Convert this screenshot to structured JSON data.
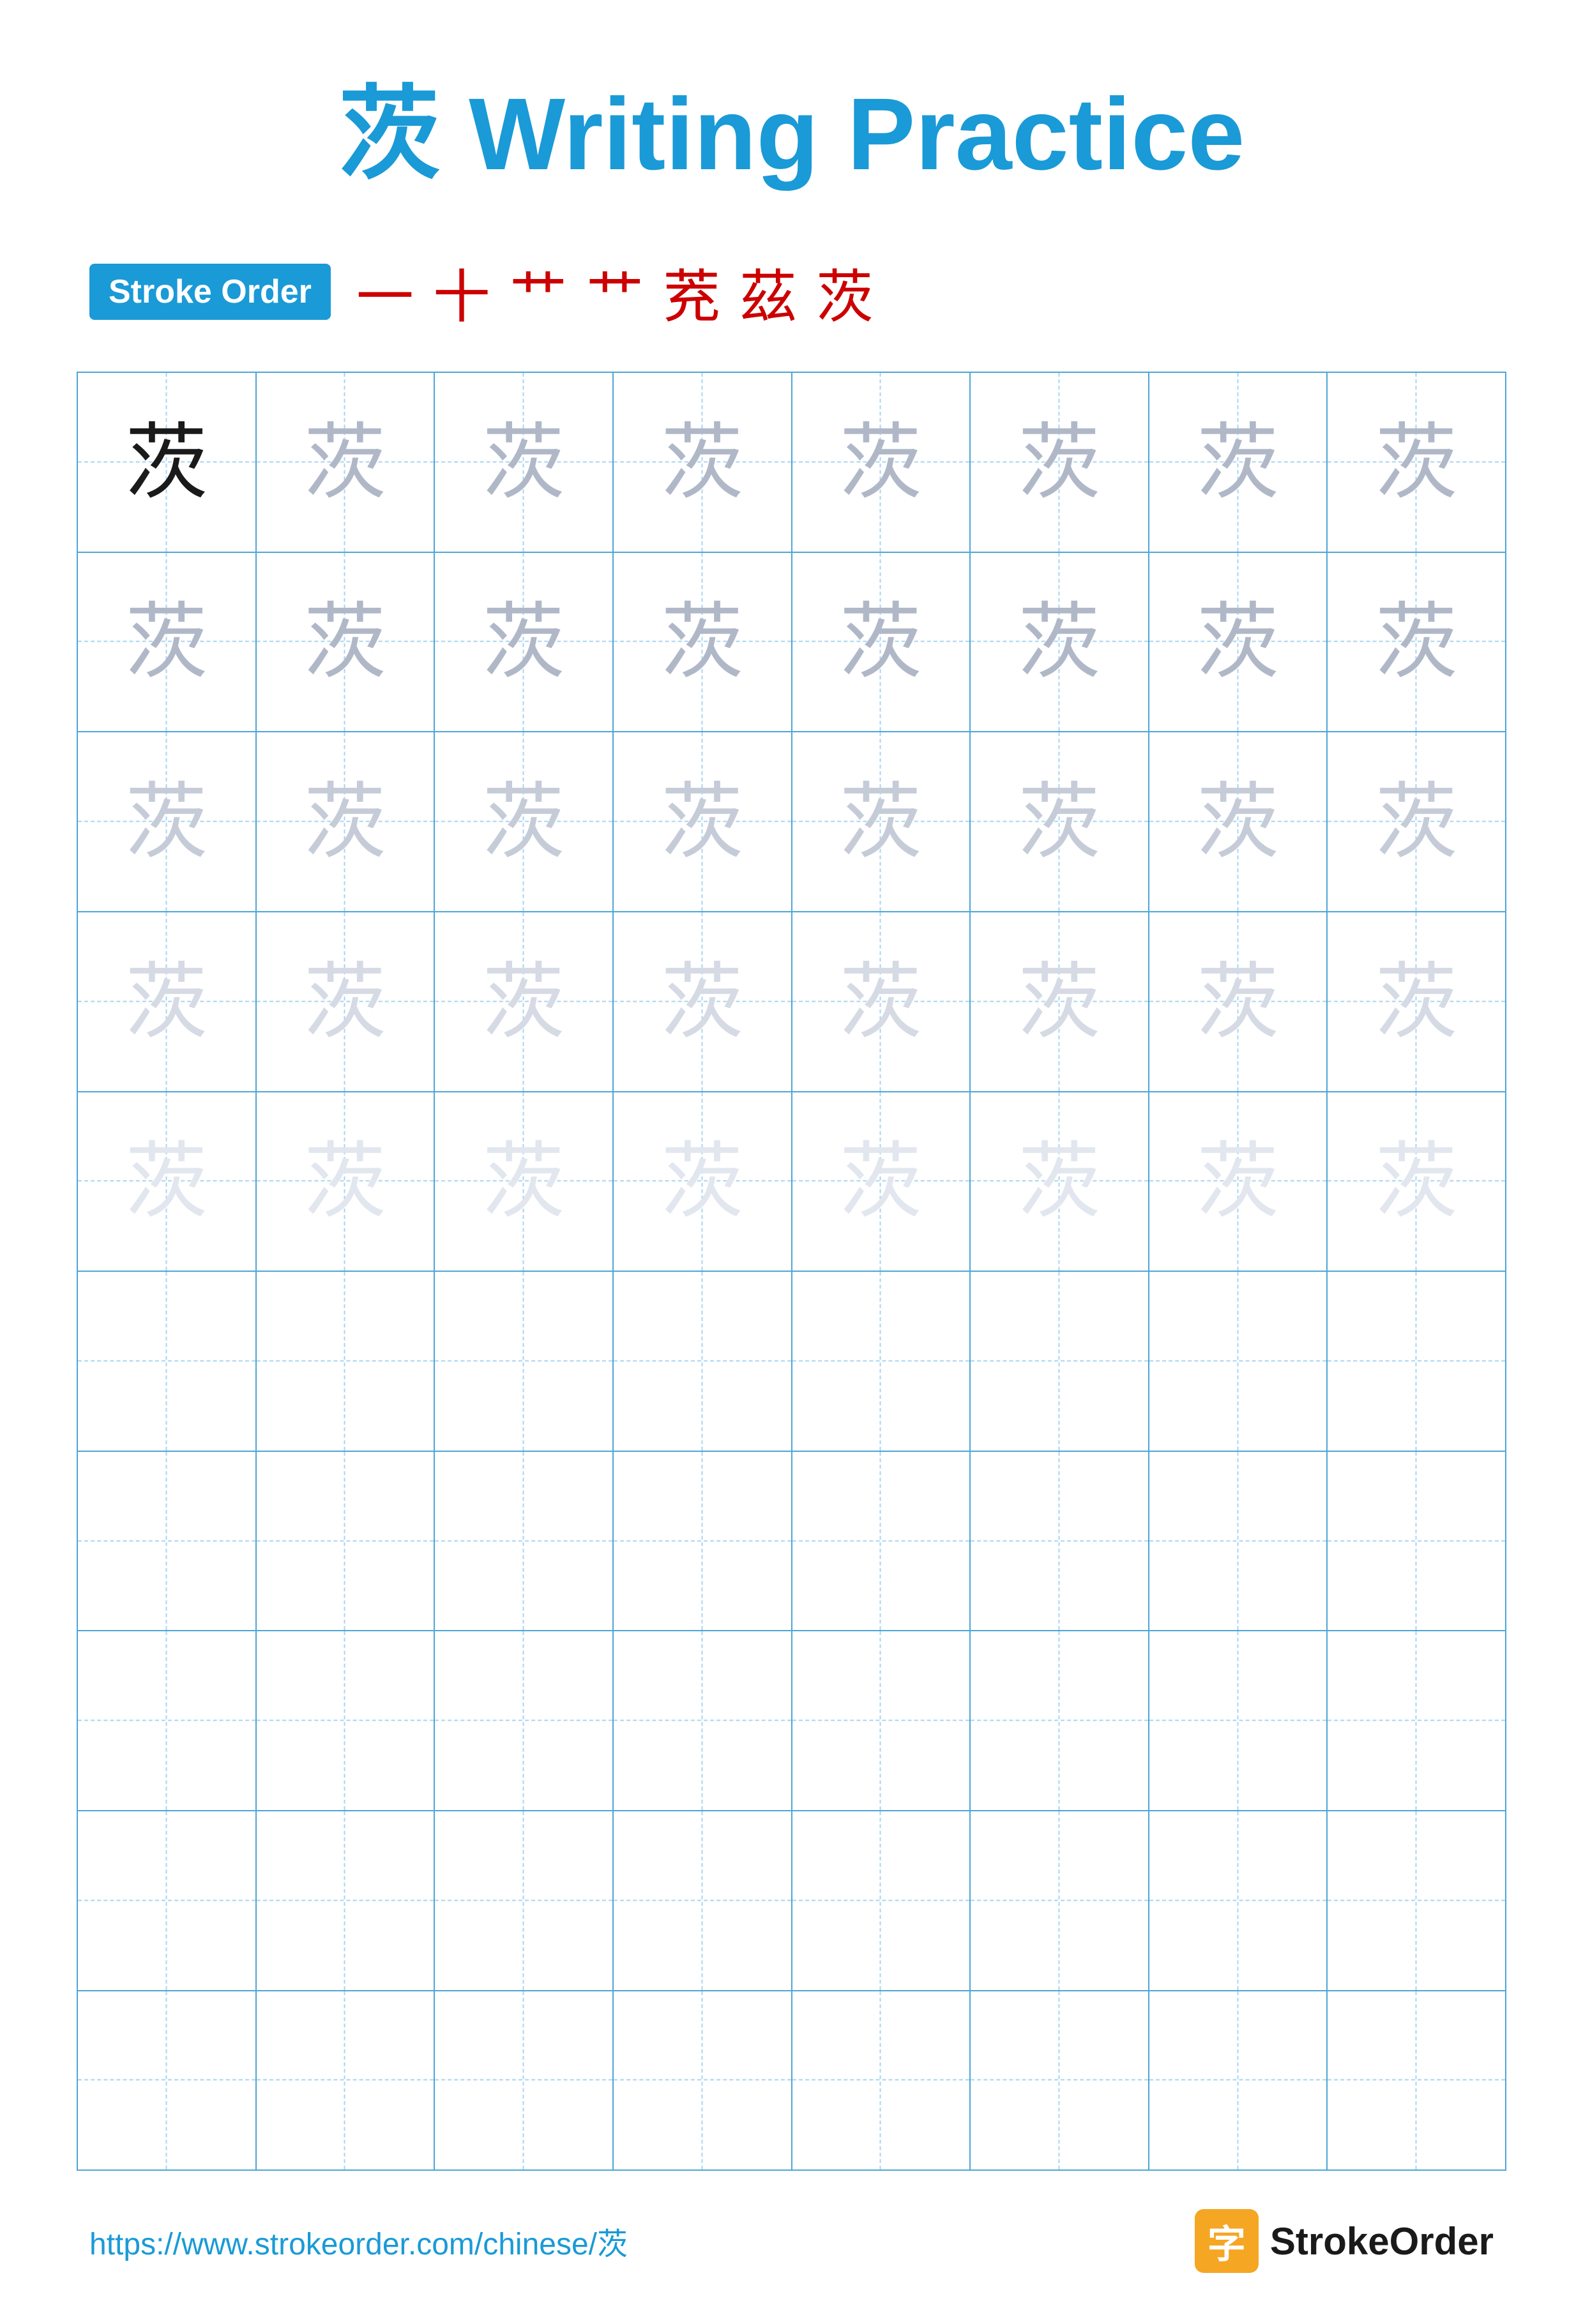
{
  "title": {
    "character": "茨",
    "suffix": " Writing Practice",
    "full": "茨 Writing Practice"
  },
  "stroke_order": {
    "badge_label": "Stroke Order",
    "strokes": [
      "一",
      "十",
      "艹",
      "艹",
      "茺",
      "茲",
      "茨"
    ]
  },
  "grid": {
    "rows": 10,
    "cols": 8,
    "character": "茨",
    "filled_rows": 5,
    "practice_rows": 5
  },
  "footer": {
    "url": "https://www.strokeorder.com/chinese/茨",
    "brand": "StrokeOrder",
    "logo_char": "字"
  },
  "colors": {
    "accent_blue": "#1a9ad6",
    "red": "#cc0000",
    "black": "#1a1a1a",
    "gray1": "#b0b8c8",
    "gray2": "#c5ccd8",
    "gray3": "#d5dae4",
    "gray4": "#e2e6ee",
    "grid_blue": "#4da6d6",
    "guide_blue": "#a8d4f0"
  }
}
